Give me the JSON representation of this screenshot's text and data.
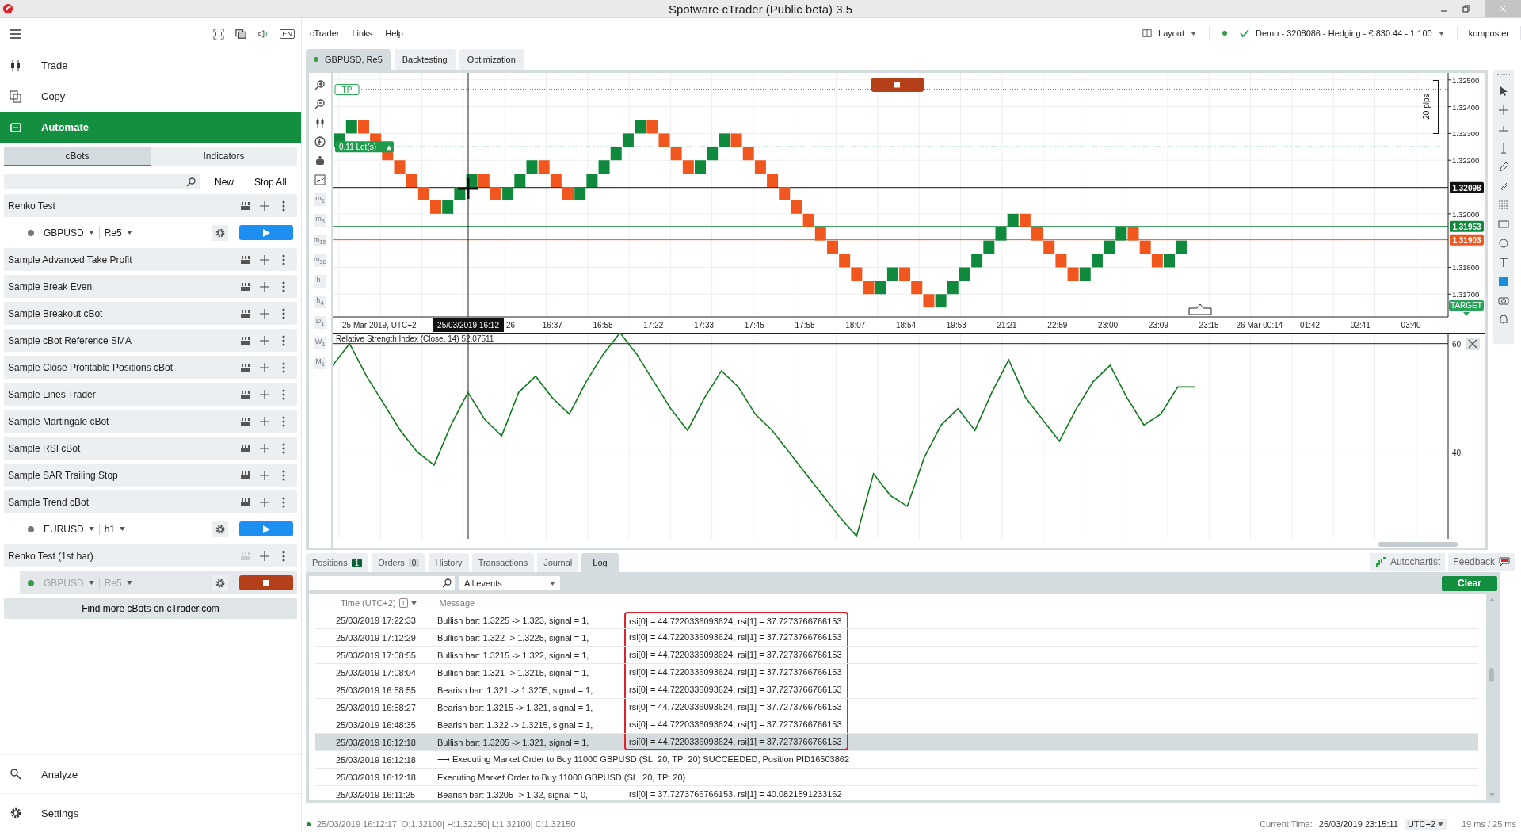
{
  "window": {
    "title": "Spotware cTrader (Public beta) 3.5"
  },
  "sidebar": {
    "language": "EN",
    "nav": [
      {
        "label": "Trade",
        "selected": false
      },
      {
        "label": "Copy",
        "selected": false
      },
      {
        "label": "Automate",
        "selected": true
      }
    ],
    "subtabs": [
      {
        "label": "cBots",
        "selected": true
      },
      {
        "label": "Indicators",
        "selected": false
      }
    ],
    "actions": [
      "New",
      "Stop All"
    ],
    "bots": [
      {
        "name": "Renko Test",
        "instances": [
          {
            "symbol": "GBPUSD",
            "timeframe": "Re5",
            "running": false
          }
        ]
      },
      {
        "name": "Sample Advanced Take Profit"
      },
      {
        "name": "Sample Break Even"
      },
      {
        "name": "Sample Breakout cBot"
      },
      {
        "name": "Sample cBot Reference SMA"
      },
      {
        "name": "Sample Close Profitable Positions cBot"
      },
      {
        "name": "Sample Lines Trader"
      },
      {
        "name": "Sample Martingale cBot"
      },
      {
        "name": "Sample RSI cBot"
      },
      {
        "name": "Sample SAR Trailing Stop"
      },
      {
        "name": "Sample Trend cBot",
        "instances": [
          {
            "symbol": "EURUSD",
            "timeframe": "h1",
            "running": false
          }
        ]
      },
      {
        "name": "Renko Test (1st bar)",
        "instances": [
          {
            "symbol": "GBPUSD",
            "timeframe": "Re5",
            "running": true
          }
        ]
      }
    ],
    "find_more": "Find more cBots on cTrader.com",
    "bottom_nav": [
      {
        "label": "Analyze",
        "selected": false
      },
      {
        "label": "Settings",
        "selected": false
      }
    ]
  },
  "menu": [
    "cTrader",
    "Links",
    "Help"
  ],
  "layout_button": "Layout",
  "account": {
    "online": true,
    "label": "Demo  - 3208086 - Hedging - € 830.44 - 1:100"
  },
  "user": "komposter",
  "chart_tabs": [
    {
      "label": "GBPUSD, Re5",
      "selected": true,
      "live": true
    },
    {
      "label": "Backtesting",
      "selected": false,
      "live": false
    },
    {
      "label": "Optimization",
      "selected": false,
      "live": false
    }
  ],
  "timeframes": [
    "m$_{1}$",
    "m$_{5}$",
    "m$_{15}$",
    "m$_{30}$",
    "h$_{1}$",
    "h$_{4}$",
    "D$_{1}$",
    "W$_{1}$",
    "M$_{1}$"
  ],
  "price_chart": {
    "price_labels": [
      "1.32500",
      "1.32400",
      "1.32300",
      "1.32200",
      "1.32000",
      "1.31800",
      "1.31700"
    ],
    "date_label": "25 Mar 2019, UTC+2",
    "cursor_time": "25/03/2019 16:12",
    "time_labels": [
      "26",
      "16:37",
      "16:58",
      "17:22",
      "17:33",
      "17:45",
      "17:58",
      "18:07",
      "18:54",
      "19:53",
      "21:21",
      "22:59",
      "23:00",
      "23:09",
      "23:15",
      "26 Mar 00:14",
      "01:42",
      "02:41",
      "03:40"
    ],
    "overlays": [
      {
        "kind": "last",
        "label": "1.32098",
        "color": "#111111"
      },
      {
        "kind": "bid",
        "label": "1.31953",
        "color": "#0f8a3c"
      },
      {
        "kind": "ask",
        "label": "1.31903",
        "color": "#f0561d"
      },
      {
        "kind": "lots",
        "label": "0.11 Lot(s)",
        "color": "#1e9c4c"
      },
      {
        "kind": "tp",
        "label": "TP",
        "color": "#1e9c4c"
      },
      {
        "kind": "range",
        "label": "20 pips",
        "color": "#111111"
      },
      {
        "kind": "target",
        "label": "TARGET",
        "color": "#2aa35a"
      }
    ]
  },
  "rsi_chart": {
    "chart_data": {
      "type": "line",
      "grid": true,
      "title": "Relative Strength Index (Close, 14) 52.07511",
      "ylim": [
        24,
        62
      ],
      "yticks": [
        40,
        60
      ],
      "series": [
        {
          "color": "#0f7a1c",
          "values": [
            56,
            60,
            54,
            49,
            44,
            40,
            37.6,
            45,
            51,
            46,
            43,
            51,
            54,
            50,
            47,
            53,
            58,
            62,
            58,
            53,
            48,
            44,
            50,
            55,
            52,
            47,
            44,
            40,
            36,
            32,
            28,
            24.5,
            36,
            32,
            30,
            39,
            45,
            48,
            44,
            51,
            57,
            50,
            46,
            42,
            48,
            53,
            56,
            50,
            45,
            47,
            52,
            52,
            null,
            null,
            null,
            null,
            null,
            null,
            null,
            null,
            null,
            null,
            null,
            null,
            null,
            null,
            null
          ]
        }
      ]
    }
  },
  "bottom_tabs": [
    {
      "label": "Positions",
      "count": "1",
      "color": "#0b5e33",
      "selected": false
    },
    {
      "label": "Orders",
      "count": "0",
      "color": "#d3dadd",
      "selected": false
    },
    {
      "label": "History",
      "selected": false
    },
    {
      "label": "Transactions",
      "selected": false
    },
    {
      "label": "Journal",
      "selected": false
    },
    {
      "label": "Log",
      "selected": true
    }
  ],
  "autochartist": "Autochartist",
  "feedback": "Feedback",
  "log": {
    "filter": "All events",
    "clear": "Clear",
    "columns": {
      "time": "Time (UTC+2)",
      "sort_index": "1",
      "message": "Message"
    },
    "rows": [
      {
        "time": "25/03/2019 17:22:33",
        "message": "Bullish bar: 1.3225 -> 1.323, signal = 1,",
        "detail": "rsi[0] = 44.7220336093624, rsi[1] = 37.7273766766153",
        "highlighted": true,
        "selected": false
      },
      {
        "time": "25/03/2019 17:12:29",
        "message": "Bullish bar: 1.322 -> 1.3225, signal = 1,",
        "detail": "rsi[0] = 44.7220336093624, rsi[1] = 37.7273766766153",
        "highlighted": true,
        "selected": false
      },
      {
        "time": "25/03/2019 17:08:55",
        "message": "Bullish bar: 1.3215 -> 1.322, signal = 1,",
        "detail": "rsi[0] = 44.7220336093624, rsi[1] = 37.7273766766153",
        "highlighted": true,
        "selected": false
      },
      {
        "time": "25/03/2019 17:08:04",
        "message": "Bullish bar: 1.321 -> 1.3215, signal = 1,",
        "detail": "rsi[0] = 44.7220336093624, rsi[1] = 37.7273766766153",
        "highlighted": true,
        "selected": false
      },
      {
        "time": "25/03/2019 16:58:55",
        "message": "Bearish bar: 1.321 -> 1.3205, signal = 1,",
        "detail": "rsi[0] = 44.7220336093624, rsi[1] = 37.7273766766153",
        "highlighted": true,
        "selected": false
      },
      {
        "time": "25/03/2019 16:58:27",
        "message": "Bearish bar: 1.3215 -> 1.321, signal = 1,",
        "detail": "rsi[0] = 44.7220336093624, rsi[1] = 37.7273766766153",
        "highlighted": true,
        "selected": false
      },
      {
        "time": "25/03/2019 16:48:35",
        "message": "Bearish bar: 1.322 -> 1.3215, signal = 1,",
        "detail": "rsi[0] = 44.7220336093624, rsi[1] = 37.7273766766153",
        "highlighted": true,
        "selected": false
      },
      {
        "time": "25/03/2019 16:12:18",
        "message": "Bullish bar: 1.3205 -> 1.321, signal = 1,",
        "detail": "rsi[0] = 44.7220336093624, rsi[1] = 37.7273766766153",
        "highlighted": true,
        "selected": true
      },
      {
        "time": "25/03/2019 16:12:18",
        "message": "⟶ Executing Market Order to Buy 11000 GBPUSD (SL: 20, TP: 20) SUCCEEDED, Position PID16503862",
        "highlighted": false,
        "selected": false
      },
      {
        "time": "25/03/2019 16:12:18",
        "message": "Executing Market Order to Buy 11000 GBPUSD (SL: 20, TP: 20)",
        "highlighted": false,
        "selected": false
      },
      {
        "time": "25/03/2019 16:11:25",
        "message": "Bearish bar: 1.3205 -> 1.32, signal = 0,",
        "detail": "rsi[0] = 37.7273766766153, rsi[1] = 40.0821591233162",
        "highlighted": false,
        "selected": false
      }
    ]
  },
  "status": {
    "connected": true,
    "bar": "25/03/2019 16:12:17| O:1.32100| H:1.32150| L:1.32100| C:1.32150",
    "time_label": "Current Time:",
    "time": "25/03/2019 23:15:11",
    "timezone": "UTC+2",
    "separator": "|",
    "latency": "19 ms / 25 ms"
  }
}
